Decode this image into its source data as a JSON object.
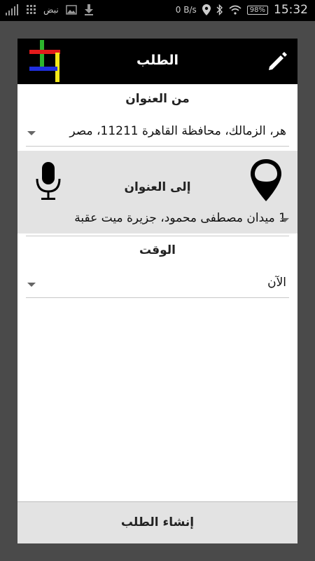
{
  "status_bar": {
    "carrier": "نبض",
    "data_rate": "0 B/s",
    "battery": "98%",
    "time": "15:32"
  },
  "dialog": {
    "title": "الطلب",
    "from": {
      "label": "من العنوان",
      "value": "هر، الزمالك، محافظة القاهرة 11211، مصر"
    },
    "to": {
      "label": "إلى العنوان",
      "value": "1 ميدان مصطفى محمود، جزيرة ميت عقبة"
    },
    "time": {
      "label": "الوقت",
      "value": "الآن"
    },
    "submit_label": "إنشاء الطلب"
  },
  "colors": {
    "titlebar": "#000000",
    "panel": "#e3e3e3",
    "logo_red": "#e31b1b",
    "logo_green": "#2db52d",
    "logo_blue": "#1f2fe0",
    "logo_yellow": "#f5e81a"
  }
}
